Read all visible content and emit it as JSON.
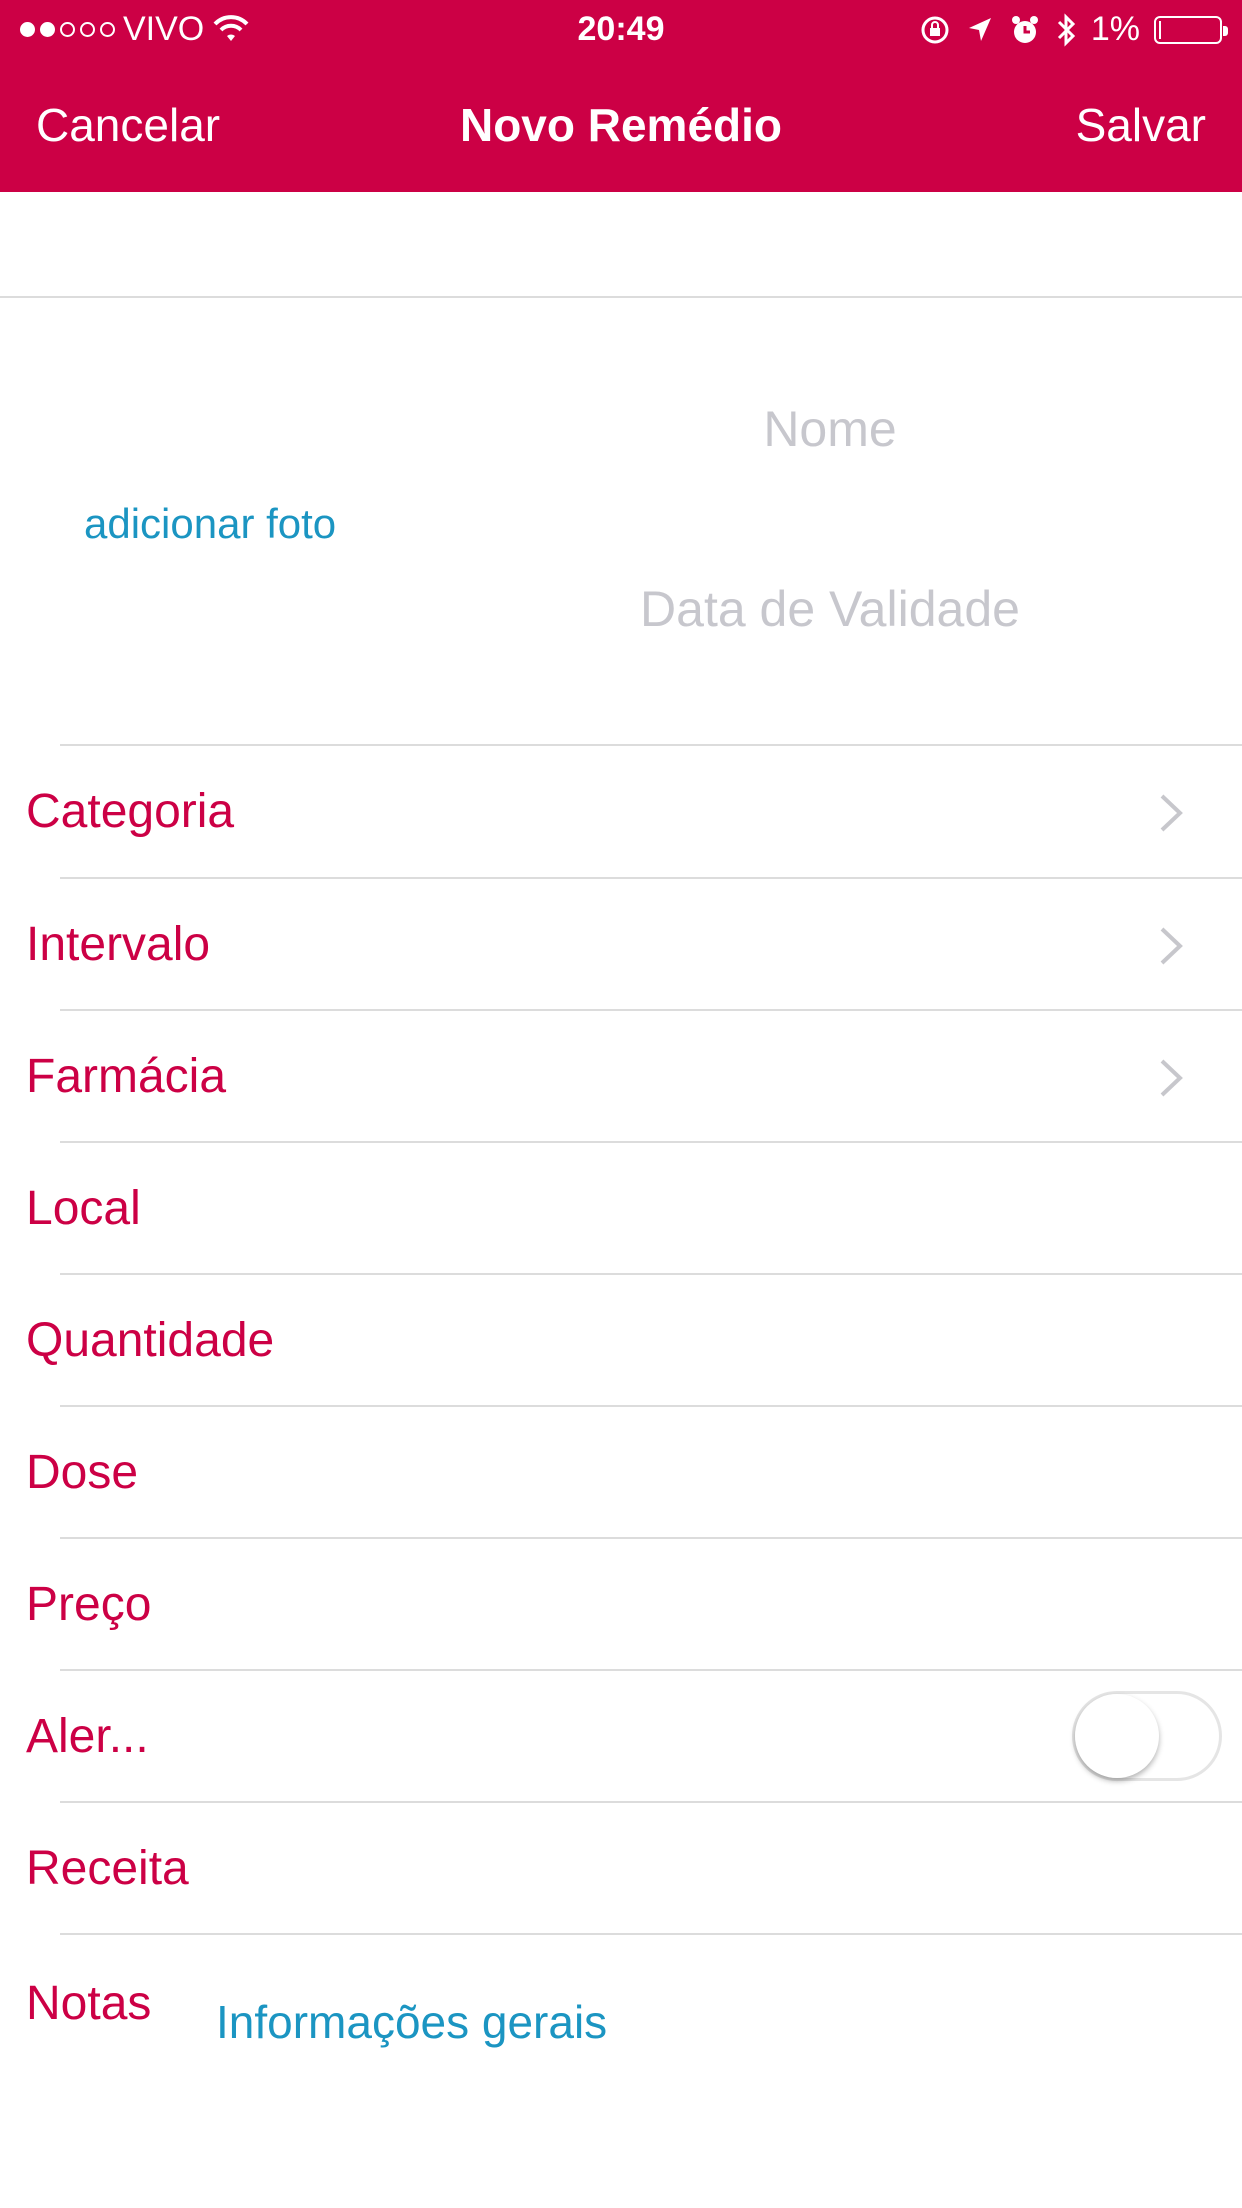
{
  "status_bar": {
    "signal_filled": 2,
    "signal_total": 5,
    "carrier": "VIVO",
    "time": "20:49",
    "battery_text": "1%",
    "battery_level": 0.01,
    "icons": [
      "wifi-icon",
      "orientation-lock-icon",
      "location-arrow-icon",
      "alarm-icon",
      "bluetooth-icon",
      "battery-icon"
    ]
  },
  "navbar": {
    "cancel_label": "Cancelar",
    "title": "Novo Remédio",
    "save_label": "Salvar"
  },
  "header": {
    "add_photo_label": "adicionar foto",
    "name_placeholder": "Nome",
    "expiry_placeholder": "Data de Validade"
  },
  "rows": [
    {
      "label": "Categoria",
      "disclosure": true
    },
    {
      "label": "Intervalo",
      "disclosure": true
    },
    {
      "label": "Farmácia",
      "disclosure": true
    },
    {
      "label": "Local",
      "disclosure": false
    },
    {
      "label": "Quantidade",
      "disclosure": false
    },
    {
      "label": "Dose",
      "disclosure": false
    },
    {
      "label": "Preço",
      "disclosure": false
    },
    {
      "label": "Aler...",
      "disclosure": false,
      "toggle": false
    },
    {
      "label": "Receita",
      "disclosure": false
    }
  ],
  "notes": {
    "label": "Notas",
    "value": "Informações gerais"
  },
  "colors": {
    "accent": "#cc0045",
    "link": "#1b95c2",
    "placeholder": "#c7c7cd",
    "separator": "#dcdcdc"
  }
}
